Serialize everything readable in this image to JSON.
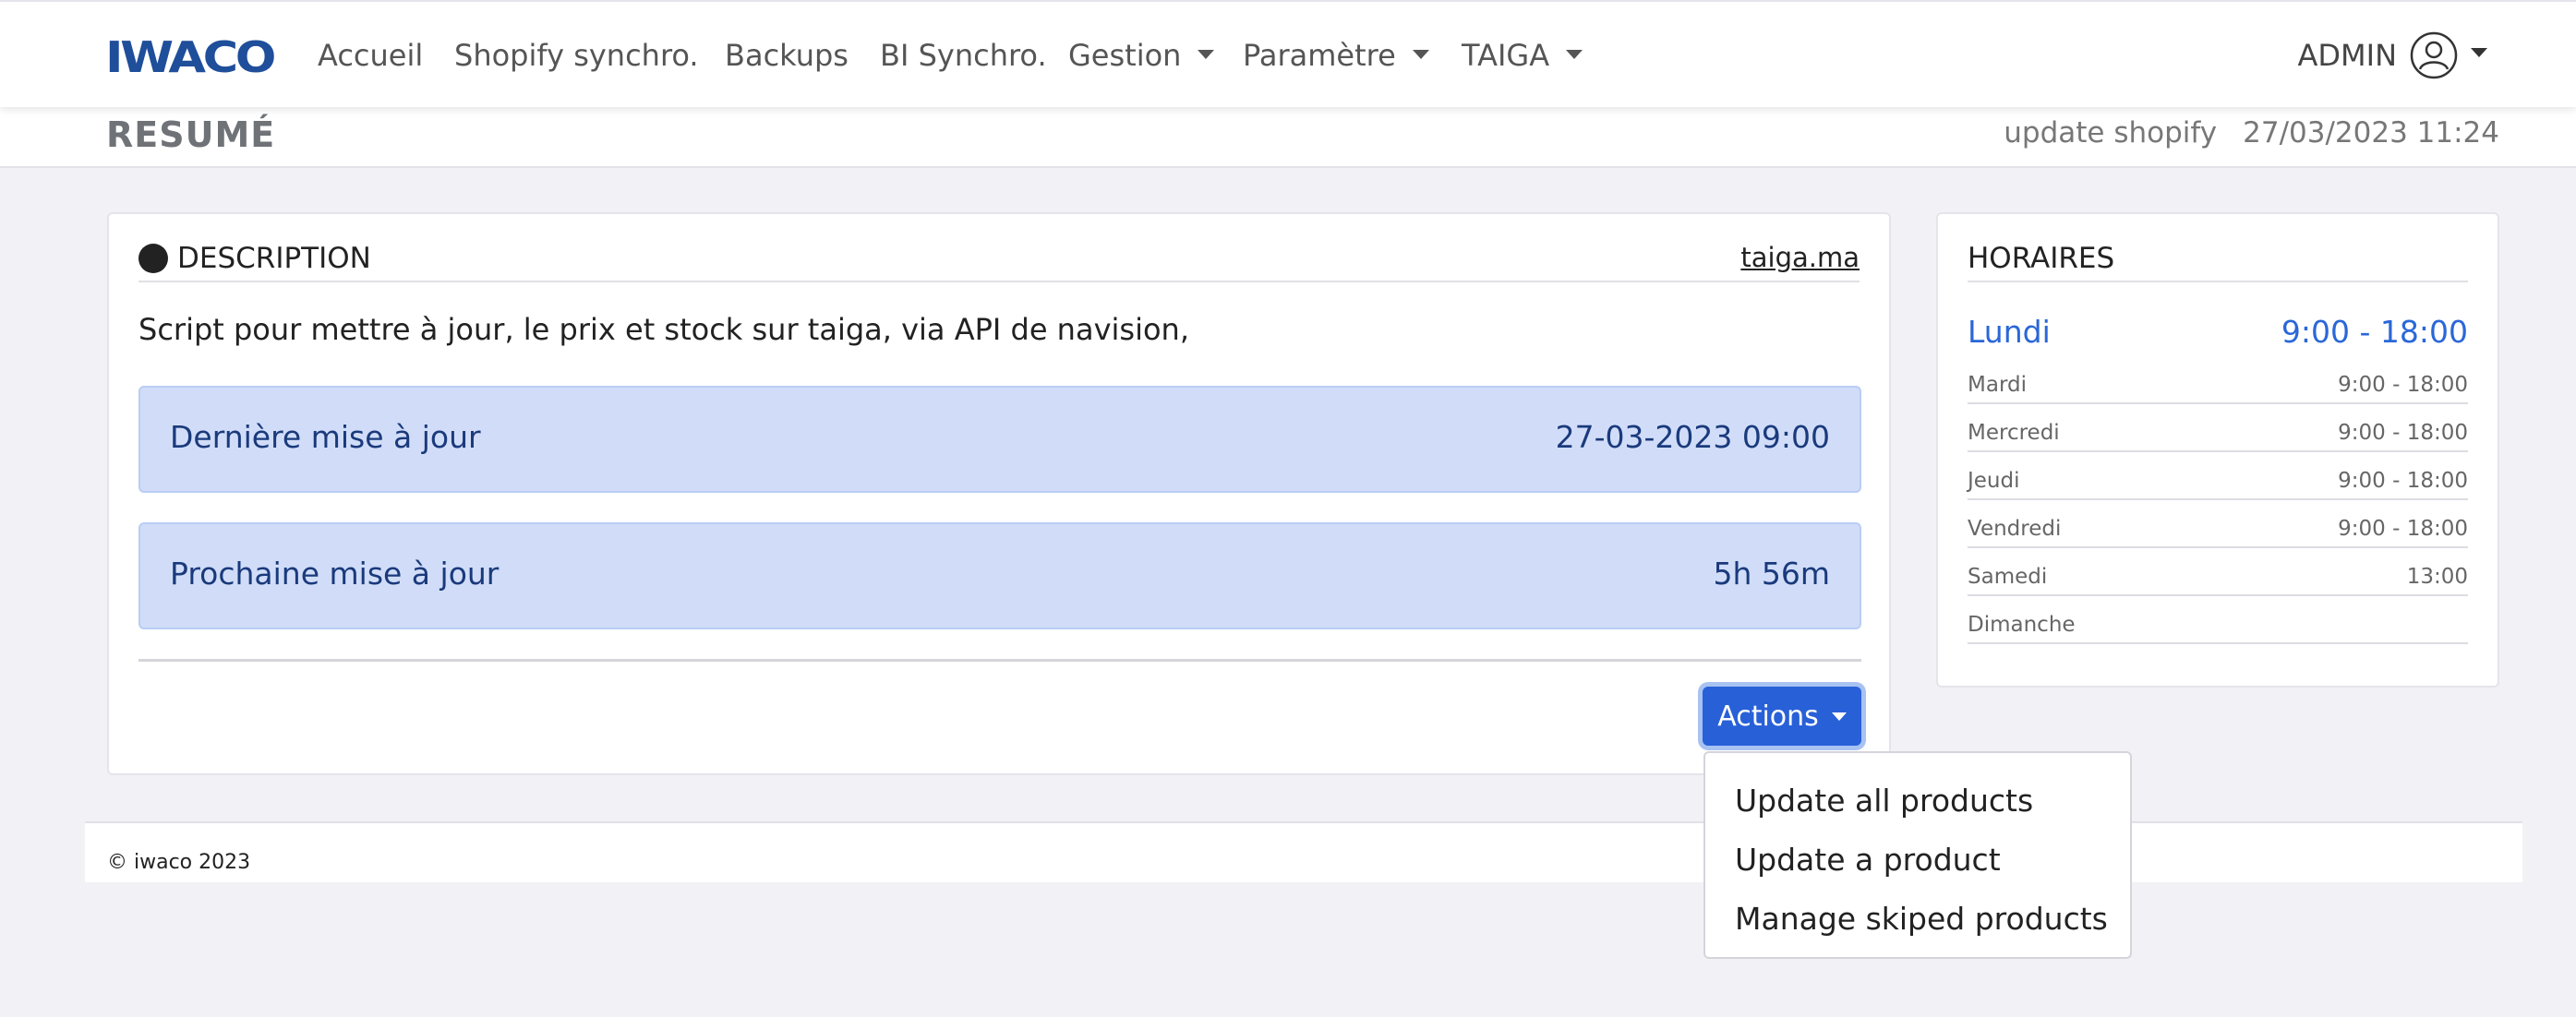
{
  "navbar": {
    "logo_text": "IWACO",
    "items": [
      {
        "label": "Accueil"
      },
      {
        "label": "Shopify synchro."
      },
      {
        "label": "Backups"
      },
      {
        "label": "BI Synchro."
      },
      {
        "label": "Gestion"
      },
      {
        "label": "Paramètre"
      },
      {
        "label": "TAIGA"
      }
    ],
    "user_label": "ADMIN"
  },
  "subheader": {
    "title": "RESUMÉ",
    "update_label": "update shopify",
    "update_time": "27/03/2023 11:24"
  },
  "description": {
    "title": "DESCRIPTION",
    "link": "taiga.ma",
    "text": "Script pour mettre à jour, le prix et stock sur taiga, via API de navision,",
    "last_update_label": "Dernière mise à jour",
    "last_update_value": "27-03-2023 09:00",
    "next_update_label": "Prochaine mise à jour",
    "next_update_value": "5h 56m",
    "actions_label": "Actions"
  },
  "actions_menu": {
    "items": [
      {
        "label": "Update all products"
      },
      {
        "label": "Update a product"
      },
      {
        "label": "Manage skiped products"
      }
    ]
  },
  "hours": {
    "title": "HORAIRES",
    "today": {
      "day": "Lundi",
      "time": "9:00 - 18:00"
    },
    "rows": [
      {
        "day": "Mardi",
        "time": "9:00 - 18:00"
      },
      {
        "day": "Mercredi",
        "time": "9:00 - 18:00"
      },
      {
        "day": "Jeudi",
        "time": "9:00 - 18:00"
      },
      {
        "day": "Vendredi",
        "time": "9:00 - 18:00"
      },
      {
        "day": "Samedi",
        "time": "13:00"
      },
      {
        "day": "Dimanche",
        "time": ""
      }
    ]
  },
  "footer": {
    "text": "© iwaco 2023"
  },
  "colors": {
    "brand": "#1f4e9a",
    "accent": "#2860d8",
    "info_bg": "#d1ddf8",
    "today_text": "#2a67d8"
  }
}
